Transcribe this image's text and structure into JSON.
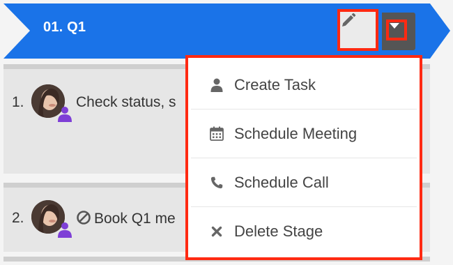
{
  "stage": {
    "title": "01. Q1",
    "color": "#1a73e8",
    "edit_icon": "pencil-icon",
    "menu_icon": "caret-down-icon"
  },
  "tasks": [
    {
      "number": "1.",
      "text": "Check status, s",
      "avatar": "avatar",
      "badge_icon": "person-icon"
    },
    {
      "number": "2.",
      "text": "Book Q1 me",
      "avatar": "avatar",
      "badge_icon": "person-icon",
      "status_icon": "ban-icon"
    }
  ],
  "menu": {
    "items": [
      {
        "label": "Create Task",
        "icon": "person-icon"
      },
      {
        "label": "Schedule Meeting",
        "icon": "calendar-icon"
      },
      {
        "label": "Schedule Call",
        "icon": "phone-icon"
      },
      {
        "label": "Delete Stage",
        "icon": "close-icon"
      }
    ]
  },
  "colors": {
    "highlight": "#ff2a12",
    "badge": "#7e3fd6"
  }
}
